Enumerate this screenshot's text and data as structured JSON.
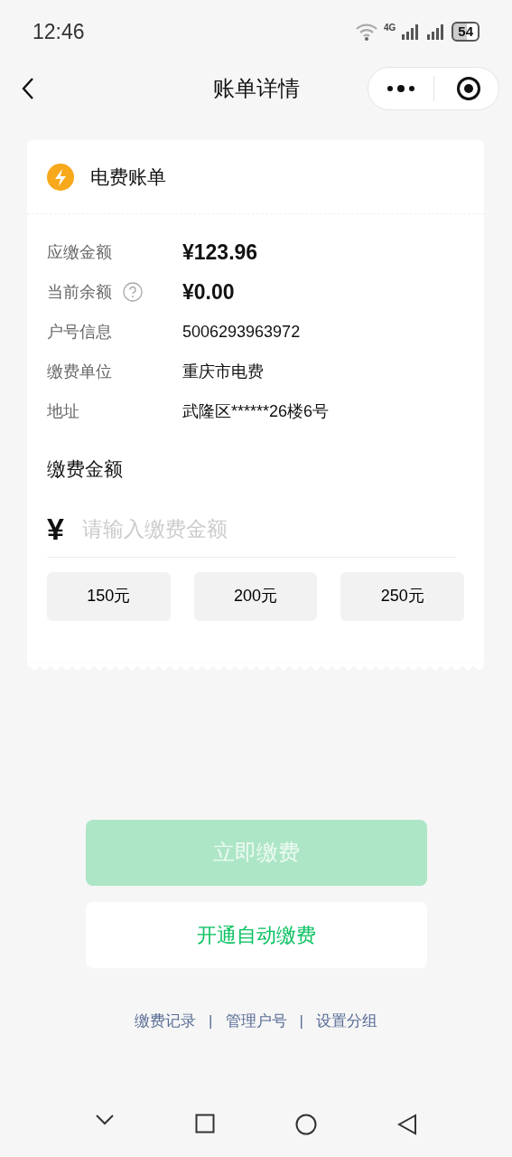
{
  "status_bar": {
    "time": "12:46",
    "network": "4G",
    "battery": "54"
  },
  "header": {
    "title": "账单详情"
  },
  "bill": {
    "title": "电费账单",
    "rows": [
      {
        "label": "应缴金额",
        "value": "¥123.96",
        "emphasis": true,
        "help": false
      },
      {
        "label": "当前余额",
        "value": "¥0.00",
        "emphasis": true,
        "help": true
      },
      {
        "label": "户号信息",
        "value": "5006293963972",
        "emphasis": false,
        "help": false
      },
      {
        "label": "缴费单位",
        "value": "重庆市电费",
        "emphasis": false,
        "help": false
      },
      {
        "label": "地址",
        "value": "武隆区******26楼6号",
        "emphasis": false,
        "help": false
      }
    ],
    "amount_title": "缴费金额",
    "currency": "¥",
    "placeholder": "请输入缴费金额",
    "quick_amounts": [
      {
        "label": "150元",
        "selected": false
      },
      {
        "label": "200元",
        "selected": false
      },
      {
        "label": "250元",
        "selected": false
      }
    ]
  },
  "pay_button": {
    "label": "立即缴费",
    "disabled": true
  },
  "auto_pay_button": {
    "label": "开通自动缴费"
  },
  "footer_links": [
    "缴费记录",
    "管理户号",
    "设置分组"
  ],
  "footer_separators": [
    "|",
    "|"
  ]
}
